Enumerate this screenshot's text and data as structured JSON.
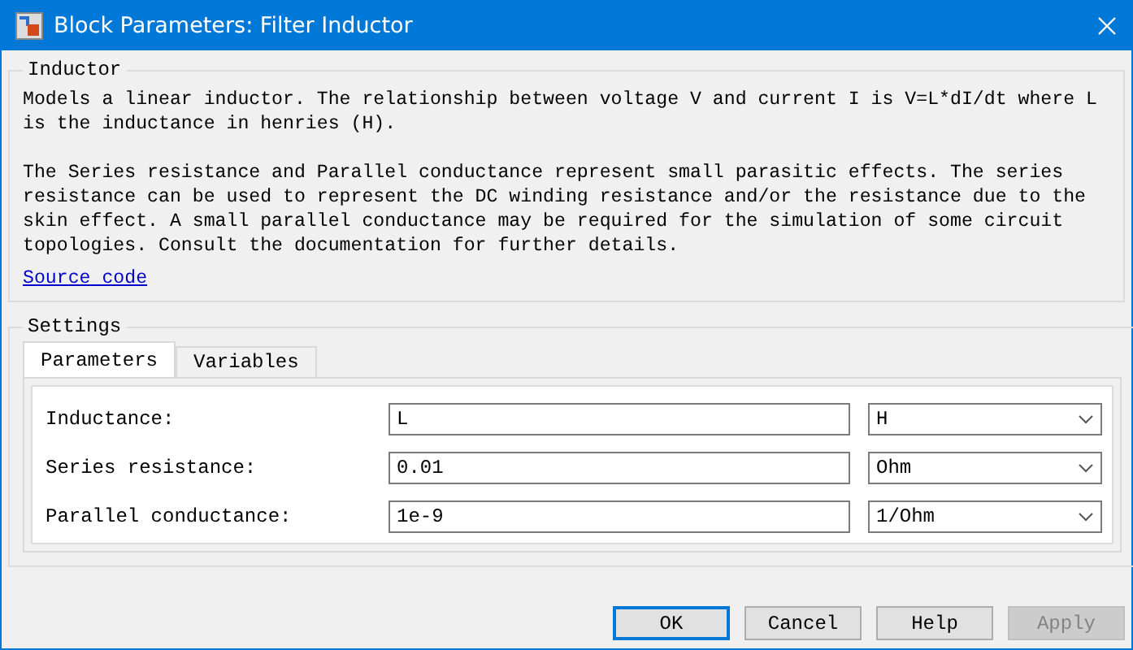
{
  "window": {
    "title": "Block Parameters: Filter Inductor"
  },
  "description": {
    "title": "Inductor",
    "paragraphs": [
      "Models a linear inductor. The relationship between voltage V and current I is V=L*dI/dt where L is the inductance in henries (H).",
      "The Series resistance and Parallel conductance represent small parasitic effects. The series resistance can be used to represent the DC winding resistance and/or the resistance due to the skin effect. A small parallel conductance may be required for the simulation of some circuit topologies. Consult the documentation for further details."
    ],
    "link": "Source code"
  },
  "settings": {
    "title": "Settings",
    "tabs": [
      {
        "label": "Parameters",
        "selected": true
      },
      {
        "label": "Variables",
        "selected": false
      }
    ],
    "parameters": [
      {
        "label": "Inductance:",
        "value": "L",
        "unit": "H"
      },
      {
        "label": "Series resistance:",
        "value": "0.01",
        "unit": "Ohm"
      },
      {
        "label": "Parallel conductance:",
        "value": "1e-9",
        "unit": "1/Ohm"
      }
    ]
  },
  "buttons": [
    {
      "label": "OK",
      "default": true,
      "disabled": false
    },
    {
      "label": "Cancel",
      "default": false,
      "disabled": false
    },
    {
      "label": "Help",
      "default": false,
      "disabled": false
    },
    {
      "label": "Apply",
      "default": false,
      "disabled": true
    }
  ]
}
